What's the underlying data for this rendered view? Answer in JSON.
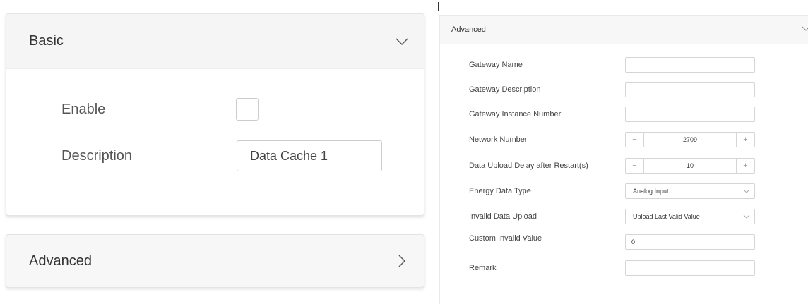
{
  "basic": {
    "title": "Basic",
    "enable_label": "Enable",
    "enable_checked": false,
    "description_label": "Description",
    "description_value": "Data Cache 1",
    "icon": "chevron-down-icon"
  },
  "advanced_collapsed": {
    "title": "Advanced",
    "icon": "chevron-right-icon"
  },
  "advanced_form": {
    "title": "Advanced",
    "icon": "chevron-down-icon",
    "gateway_name_label": "Gateway Name",
    "gateway_name_value": "",
    "gateway_description_label": "Gateway Description",
    "gateway_description_value": "",
    "gateway_instance_label": "Gateway Instance Number",
    "gateway_instance_value": "",
    "network_number_label": "Network Number",
    "network_number_value": "2709",
    "upload_delay_label": "Data Upload Delay after Restart(s)",
    "upload_delay_value": "10",
    "energy_type_label": "Energy Data Type",
    "energy_type_value": "Analog Input",
    "invalid_upload_label": "Invalid Data Upload",
    "invalid_upload_value": "Upload Last Valid Value",
    "custom_invalid_label": "Custom Invalid Value",
    "custom_invalid_value": "0",
    "remark_label": "Remark",
    "remark_value": "",
    "stepper_minus": "−",
    "stepper_plus": "+"
  }
}
